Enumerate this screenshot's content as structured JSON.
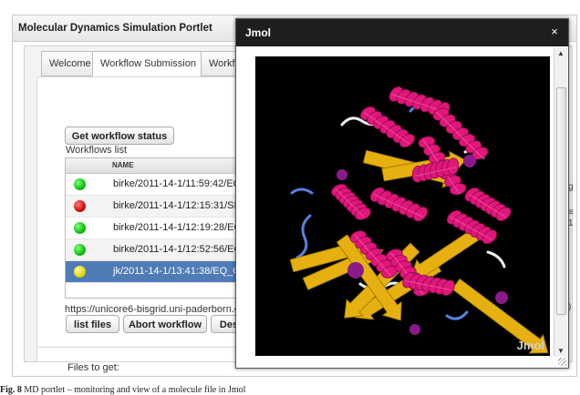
{
  "portlet": {
    "title": "Molecular Dynamics Simulation Portlet",
    "tabs": [
      {
        "label": "Welcome"
      },
      {
        "label": "Workflow Submission"
      },
      {
        "label": "Workflo"
      }
    ],
    "status_button": "Get workflow status",
    "workflows_label": "Workflows list",
    "table_header": "NAME",
    "workflows": [
      {
        "name": "birke/2011-14-1/11:59:42/EQ_",
        "status": "green"
      },
      {
        "name": "birke/2011-14-1/12:15:31/SIN",
        "status": "red"
      },
      {
        "name": "birke/2011-14-1/12:19:28/EQ_",
        "status": "green"
      },
      {
        "name": "birke/2011-14-1/12:52:56/EQ_",
        "status": "green"
      },
      {
        "name": "jk/2011-14-1/13:41:38/EQ_Gr",
        "status": "yellow"
      }
    ],
    "url": "https://unicore6-bisgrid.uni-paderborn.de:",
    "buttons": {
      "list_files": "list files",
      "abort": "Abort workflow",
      "des": "Des"
    },
    "files_label": "Files to get:"
  },
  "jmol": {
    "title": "Jmol",
    "close": "×",
    "watermark": "Jmol"
  },
  "edge_glyphs": [
    "g",
    "≡",
    "1",
    ")"
  ],
  "caption": {
    "fig": "Fig. 8",
    "text": "  MD portlet – monitoring and view of a molecule file in Jmol"
  },
  "colors": {
    "helix": "#e0167a",
    "sheet": "#e6b010",
    "coil": "#f0f0f0",
    "loop": "#5a7fe0",
    "canvas_bg": "#000000",
    "selected_row": "#4f7bb7"
  }
}
